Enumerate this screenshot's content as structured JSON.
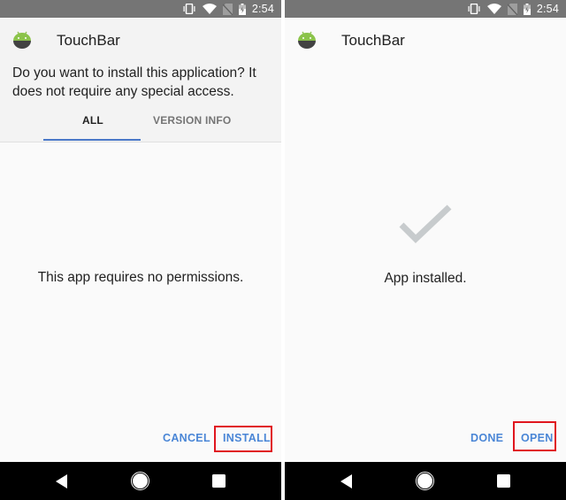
{
  "status_bar": {
    "time": "2:54",
    "icons": [
      "vibrate-icon",
      "wifi-icon",
      "no-sim-icon",
      "battery-charging-icon"
    ]
  },
  "app": {
    "name": "TouchBar",
    "icon": "android-icon"
  },
  "install_screen": {
    "prompt": "Do you want to install this application? It does not require any special access.",
    "tabs": [
      {
        "label": "ALL",
        "active": true
      },
      {
        "label": "VERSION INFO",
        "active": false
      }
    ],
    "message": "This app requires no permissions.",
    "actions": {
      "cancel_label": "CANCEL",
      "install_label": "INSTALL"
    },
    "highlighted_action": "INSTALL"
  },
  "installed_screen": {
    "status_icon": "check-icon",
    "message": "App installed.",
    "actions": {
      "done_label": "DONE",
      "open_label": "OPEN"
    },
    "highlighted_action": "OPEN"
  },
  "nav_bar": {
    "buttons": [
      "back-icon",
      "home-icon",
      "recents-icon"
    ]
  },
  "colors": {
    "accent": "#4a86d6",
    "tab_indicator": "#4a78c8",
    "highlight": "#e0161e",
    "status_bar": "#757575",
    "android_green": "#8bc34a"
  }
}
